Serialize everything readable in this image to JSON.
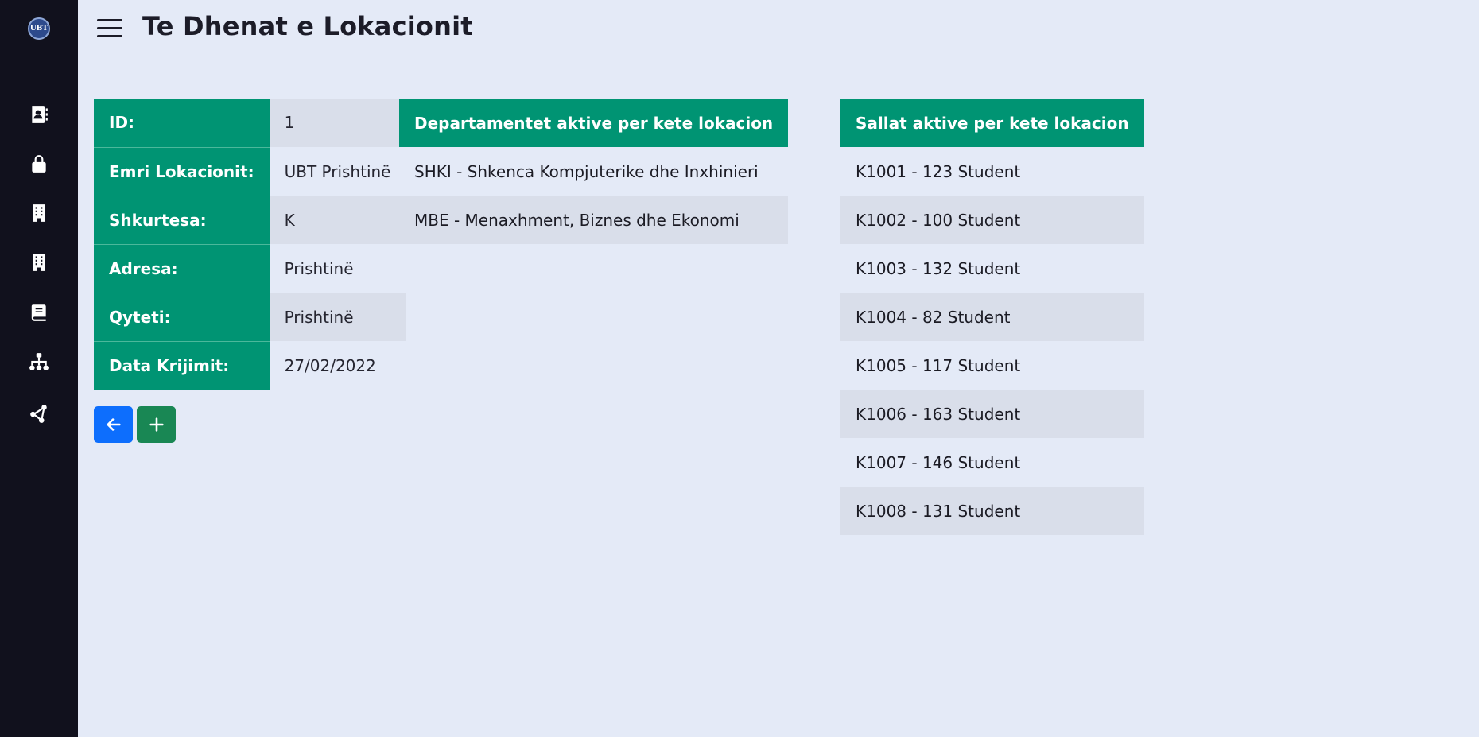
{
  "page": {
    "title": "Te Dhenat e Lokacionit"
  },
  "sidebar": {
    "logo_text": "UBT",
    "items": [
      {
        "icon": "contact-book-icon"
      },
      {
        "icon": "lock-icon"
      },
      {
        "icon": "building-icon"
      },
      {
        "icon": "building-icon"
      },
      {
        "icon": "book-icon"
      },
      {
        "icon": "hierarchy-icon"
      },
      {
        "icon": "share-nodes-icon"
      }
    ]
  },
  "location": {
    "rows": [
      {
        "label": "ID:",
        "value": "1"
      },
      {
        "label": "Emri Lokacionit:",
        "value": "UBT Prishtinë"
      },
      {
        "label": "Shkurtesa:",
        "value": "K"
      },
      {
        "label": "Adresa:",
        "value": "Prishtinë"
      },
      {
        "label": "Qyteti:",
        "value": "Prishtinë"
      },
      {
        "label": "Data Krijimit:",
        "value": "27/02/2022"
      }
    ]
  },
  "departments": {
    "header": "Departamentet aktive per kete lokacion",
    "items": [
      "SHKI - Shkenca Kompjuterike dhe Inxhinieri",
      "MBE - Menaxhment, Biznes dhe Ekonomi"
    ]
  },
  "rooms": {
    "header": "Sallat aktive per kete lokacion",
    "items": [
      "K1001 - 123 Student",
      "K1002 - 100 Student",
      "K1003 - 132 Student",
      "K1004 - 82 Student",
      "K1005 - 117 Student",
      "K1006 - 163 Student",
      "K1007 - 146 Student",
      "K1008 - 131 Student"
    ]
  },
  "buttons": {
    "back_icon": "arrow-left-icon",
    "add_icon": "plus-icon"
  },
  "colors": {
    "sidebar": "#11111d",
    "background": "#e4eaf7",
    "table_header": "#009473",
    "back_button": "#0d6efd",
    "add_button": "#198754"
  }
}
